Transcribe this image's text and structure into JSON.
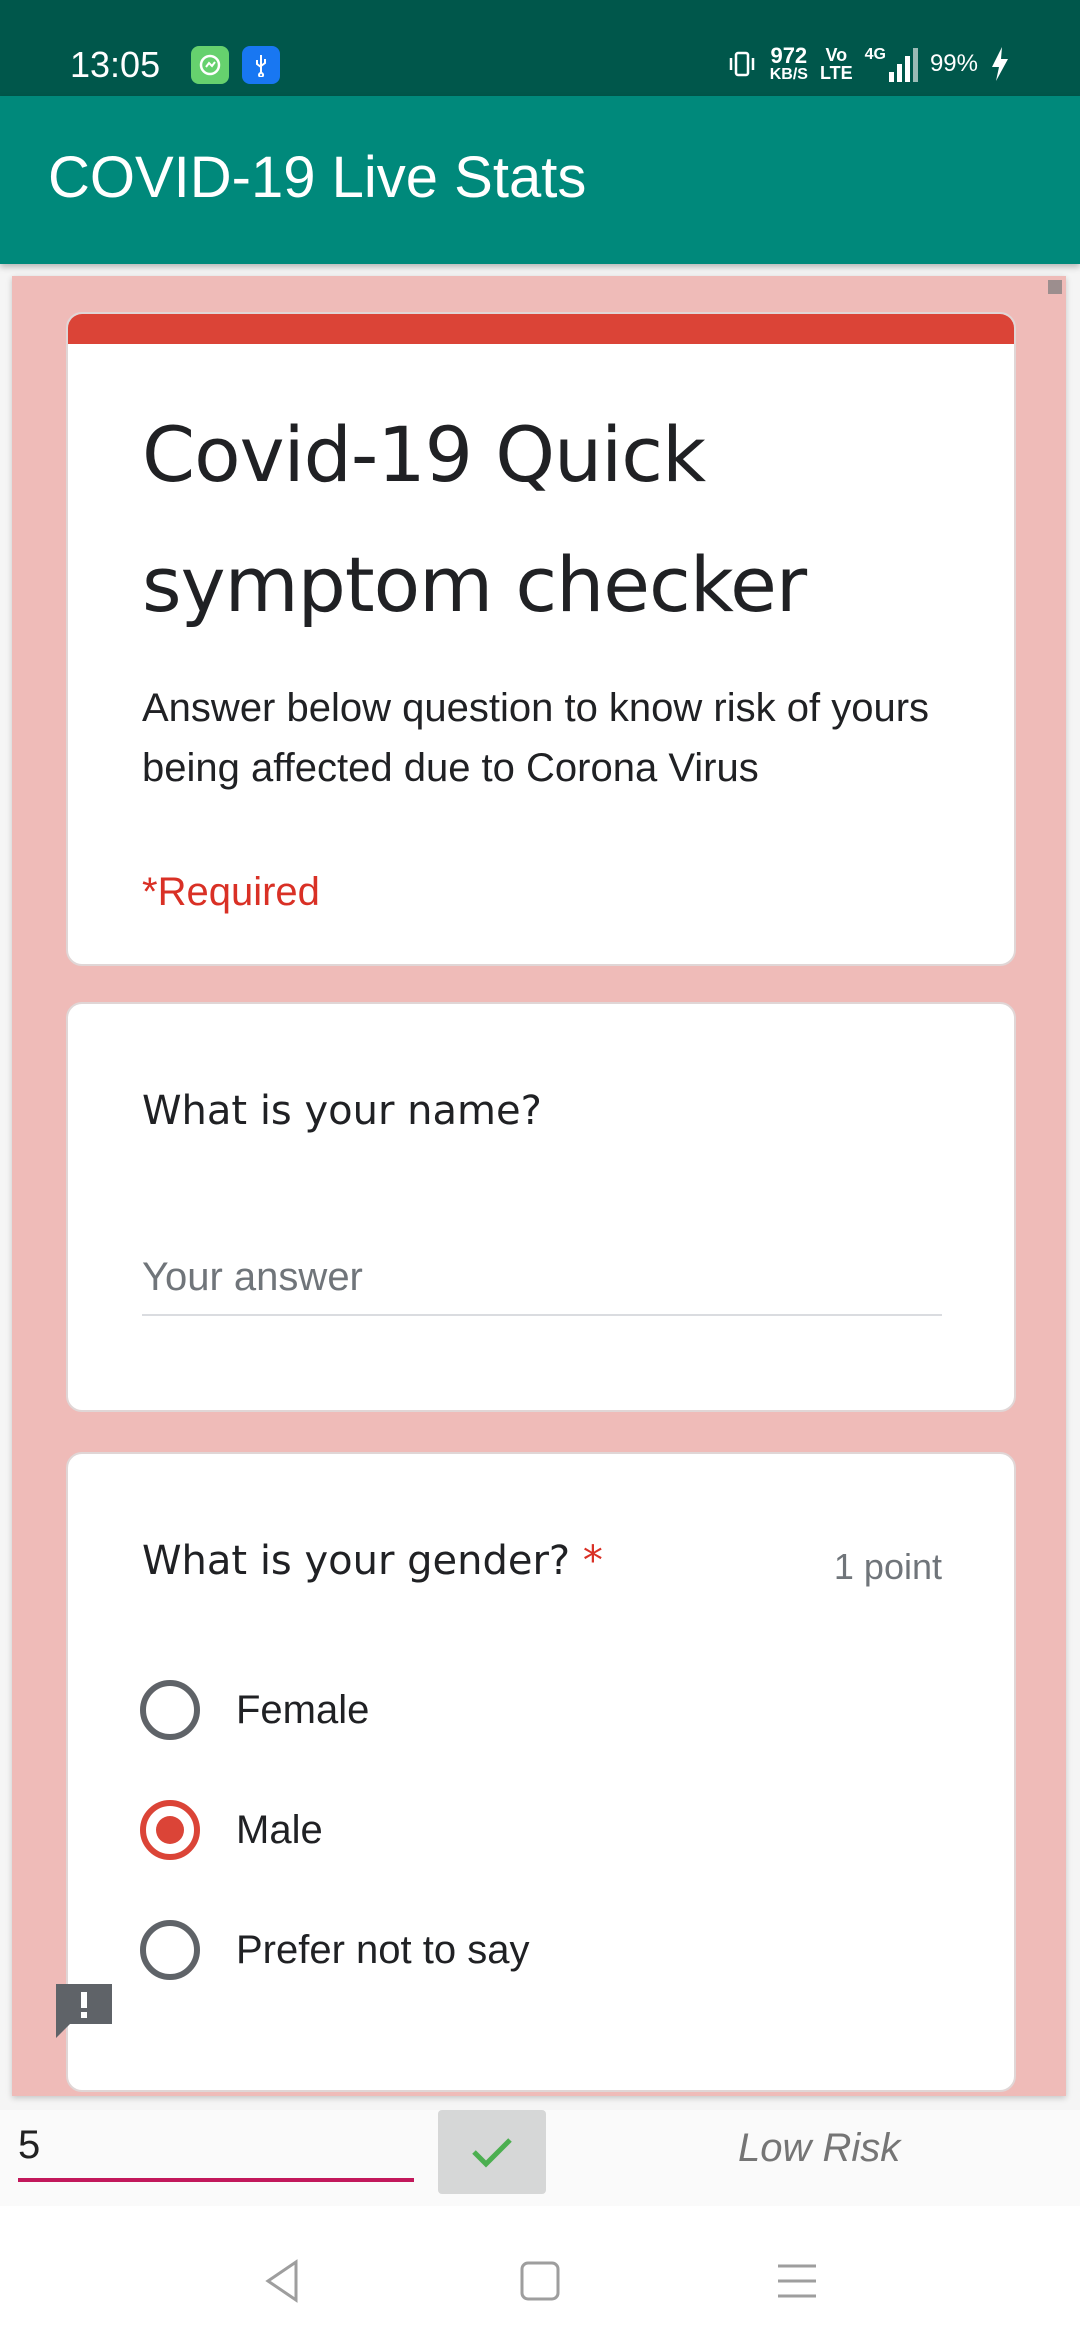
{
  "status_bar": {
    "time": "13:05",
    "net_speed_value": "972",
    "net_speed_unit": "KB/S",
    "volte_top": "Vo",
    "volte_bottom": "LTE",
    "network": "4G",
    "battery": "99%",
    "icons": [
      "messenger-icon",
      "usb-icon",
      "vibrate-icon",
      "signal-icon",
      "charging-icon"
    ]
  },
  "app_bar": {
    "title": "COVID-19 Live Stats",
    "color": "#00897b"
  },
  "form": {
    "accent_color": "#db4437",
    "background_color": "#efbbb8",
    "title": "Covid-19 Quick symptom checker",
    "description": "Answer below question to know risk of yours being affected due to Corona  Virus",
    "required_note": "*Required",
    "questions": [
      {
        "title": "What is your name?",
        "placeholder": "Your answer",
        "value": ""
      },
      {
        "title": "What is your gender?",
        "required_marker": "*",
        "points": "1 point",
        "options": [
          "Female",
          "Male",
          "Prefer not to say"
        ],
        "selected": "Male"
      }
    ]
  },
  "bottom": {
    "score_value": "5",
    "risk_label": "Low Risk",
    "underline_color": "#c2185b"
  },
  "nav": {
    "buttons": [
      "back-icon",
      "home-icon",
      "menu-icon"
    ]
  }
}
